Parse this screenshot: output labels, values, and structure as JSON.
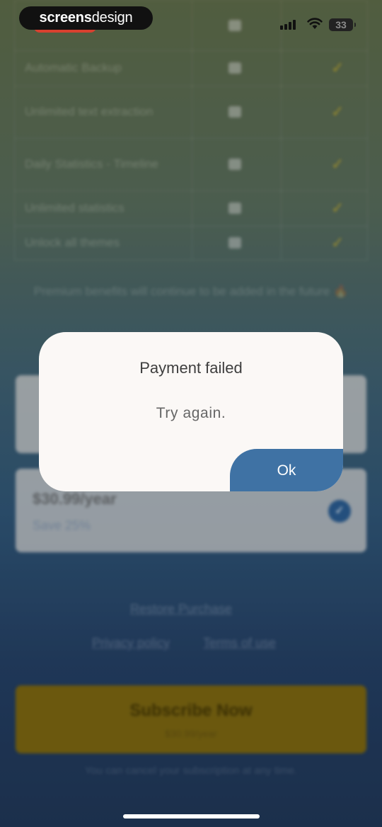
{
  "status_bar": {
    "watermark_prefix": "screens",
    "watermark_suffix": "design",
    "battery": "33"
  },
  "background": {
    "feature_rows": [
      {
        "label": "Automatic Backup"
      },
      {
        "label": "Unlimited text extraction"
      },
      {
        "label": "Daily Statistics - Timeline"
      },
      {
        "label": "Unlimited statistics"
      },
      {
        "label": "Unlock all themes"
      }
    ],
    "note": "Premium benefits will continue to be added in the future 🔥",
    "yearly_plan": {
      "price": "$30.99/year",
      "save": "Save 25%"
    },
    "restore_label": "Restore Purchase",
    "privacy_label": "Privacy policy",
    "terms_label": "Terms of use",
    "subscribe": {
      "label": "Subscribe Now",
      "price": "$30.99/year"
    },
    "cancel_note": "You can cancel your subscription at any time."
  },
  "dialog": {
    "title": "Payment failed",
    "message": "Try again.",
    "ok_label": "Ok"
  }
}
